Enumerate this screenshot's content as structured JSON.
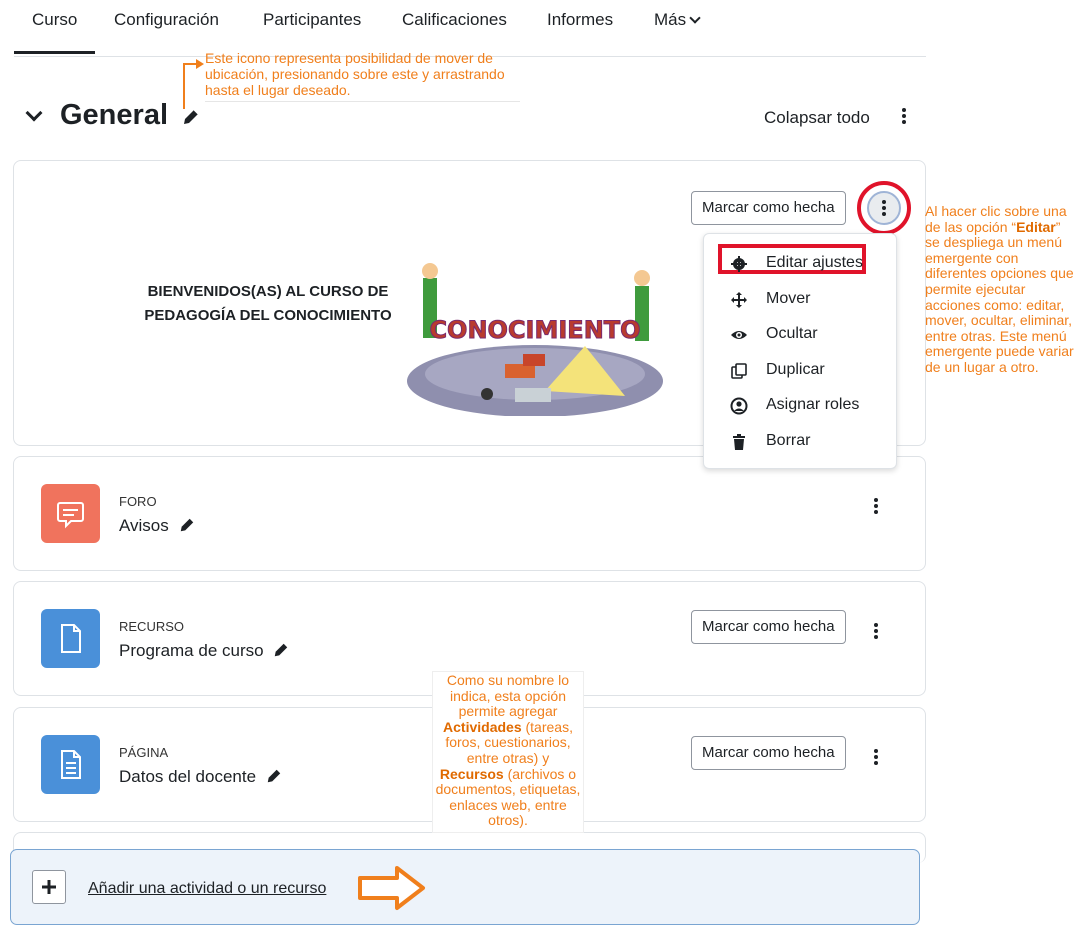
{
  "nav": {
    "tabs": [
      "Curso",
      "Configuración",
      "Participantes",
      "Calificaciones",
      "Informes",
      "Más"
    ]
  },
  "annotations": {
    "move_icon": "Este icono representa posibilidad de mover de ubicación, presionando sobre este y arrastrando hasta el lugar deseado.",
    "edit_menu_before": "Al hacer clic sobre una de las opción “",
    "edit_menu_bold": "Editar",
    "edit_menu_after": "” se despliega un menú emergente con diferentes opciones que permite ejecutar acciones como: editar, mover, ocultar, eliminar, entre otras. Este menú emergente puede variar de un lugar a otro.",
    "add_p1": "Como su nombre lo indica, esta opción permite agregar ",
    "add_b1": "Actividades",
    "add_p2": " (tareas, foros, cuestionarios, entre otras) y ",
    "add_b2": "Recursos",
    "add_p3": " (archivos o documentos, etiquetas, enlaces web, entre otros)."
  },
  "section": {
    "title": "General",
    "collapse_all": "Colapsar todo"
  },
  "summary": {
    "welcome_text": "BIENVENIDOS(AS) AL CURSO DE PEDAGOGÍA DEL CONOCIMIENTO",
    "mark_done": "Marcar como hecha",
    "image_word": "CONOCIMIENTO"
  },
  "menu": {
    "items": [
      "Editar ajustes",
      "Mover",
      "Ocultar",
      "Duplicar",
      "Asignar roles",
      "Borrar"
    ]
  },
  "activities": [
    {
      "type": "FORO",
      "name": "Avisos",
      "color": "#f0735d"
    },
    {
      "type": "RECURSO",
      "name": "Programa de curso",
      "color": "#4a90d9",
      "mark": "Marcar como hecha"
    },
    {
      "type": "PÁGINA",
      "name": "Datos del docente",
      "color": "#4a90d9",
      "mark": "Marcar como hecha"
    }
  ],
  "add": {
    "label": "Añadir una actividad o un recurso"
  },
  "colors": {
    "annotation": "#f07f1c",
    "highlight": "#e0132a",
    "add_box_bg": "#edf3fa"
  }
}
